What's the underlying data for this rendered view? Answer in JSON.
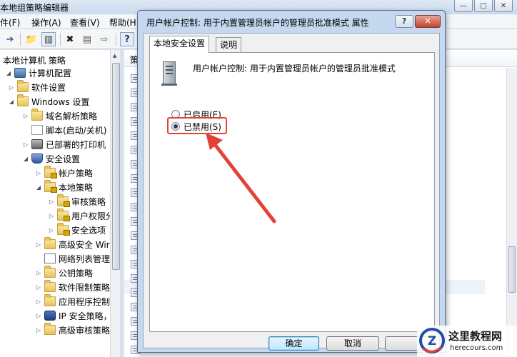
{
  "app": {
    "title": "本地组策略编辑器",
    "controls": [
      "—",
      "□",
      "✕"
    ]
  },
  "menu": [
    "文件(F)",
    "操作(A)",
    "查看(V)",
    "帮助(H)"
  ],
  "toolbar": {
    "icons": [
      "forward-arrow-icon",
      "up-folder-icon",
      "show-tree-icon",
      "delete-icon",
      "properties-icon",
      "export-icon",
      "help-icon"
    ],
    "glyphs": [
      "➔",
      "📁",
      "▥",
      "✖",
      "▤",
      "⇨",
      "?"
    ]
  },
  "tree": {
    "root": "本地计算机 策略",
    "items": [
      {
        "label": "计算机配置",
        "icon": "pc",
        "indent": 0,
        "twisty": "◢"
      },
      {
        "label": "软件设置",
        "icon": "folder",
        "indent": 1,
        "twisty": "▷"
      },
      {
        "label": "Windows 设置",
        "icon": "folder",
        "indent": 1,
        "twisty": "◢"
      },
      {
        "label": "域名解析策略",
        "icon": "folder",
        "indent": 2,
        "twisty": "▷"
      },
      {
        "label": "脚本(启动/关机)",
        "icon": "script",
        "indent": 2,
        "twisty": ""
      },
      {
        "label": "已部署的打印机",
        "icon": "printer",
        "indent": 2,
        "twisty": "▷"
      },
      {
        "label": "安全设置",
        "icon": "shield",
        "indent": 2,
        "twisty": "◢"
      },
      {
        "label": "帐户策略",
        "icon": "lockfolder",
        "indent": 3,
        "twisty": "▷"
      },
      {
        "label": "本地策略",
        "icon": "lockfolder",
        "indent": 3,
        "twisty": "◢"
      },
      {
        "label": "审核策略",
        "icon": "lockfolder",
        "indent": 4,
        "twisty": "▷"
      },
      {
        "label": "用户权限分",
        "icon": "lockfolder",
        "indent": 4,
        "twisty": "▷"
      },
      {
        "label": "安全选项",
        "icon": "lockfolder",
        "indent": 4,
        "twisty": "▷"
      },
      {
        "label": "高级安全 Wir",
        "icon": "folder",
        "indent": 3,
        "twisty": "▷"
      },
      {
        "label": "网络列表管理",
        "icon": "netlist",
        "indent": 3,
        "twisty": ""
      },
      {
        "label": "公钥策略",
        "icon": "folder",
        "indent": 3,
        "twisty": "▷"
      },
      {
        "label": "软件限制策略",
        "icon": "folder",
        "indent": 3,
        "twisty": "▷"
      },
      {
        "label": "应用程序控制",
        "icon": "folder",
        "indent": 3,
        "twisty": "▷"
      },
      {
        "label": "IP 安全策略，",
        "icon": "ipsec",
        "indent": 3,
        "twisty": "▷"
      },
      {
        "label": "高级审核策略",
        "icon": "folder",
        "indent": 3,
        "twisty": "▷"
      }
    ]
  },
  "list": {
    "header": "策"
  },
  "dialog": {
    "title": "用户帐户控制: 用于内置管理员帐户的管理员批准模式 属性",
    "help": "?",
    "close": "✕",
    "tabs": [
      "本地安全设置",
      "说明"
    ],
    "policy_name": "用户帐户控制: 用于内置管理员帐户的管理员批准模式",
    "options": [
      {
        "label": "已启用(E)",
        "checked": false
      },
      {
        "label": "已禁用(S)",
        "checked": true
      }
    ],
    "ok": "确定",
    "cancel": "取消"
  },
  "watermark": {
    "title": "这里教程网",
    "url": "herecours.com",
    "logo_letter": "Z"
  },
  "colors": {
    "annotation_red": "#e3413a"
  }
}
